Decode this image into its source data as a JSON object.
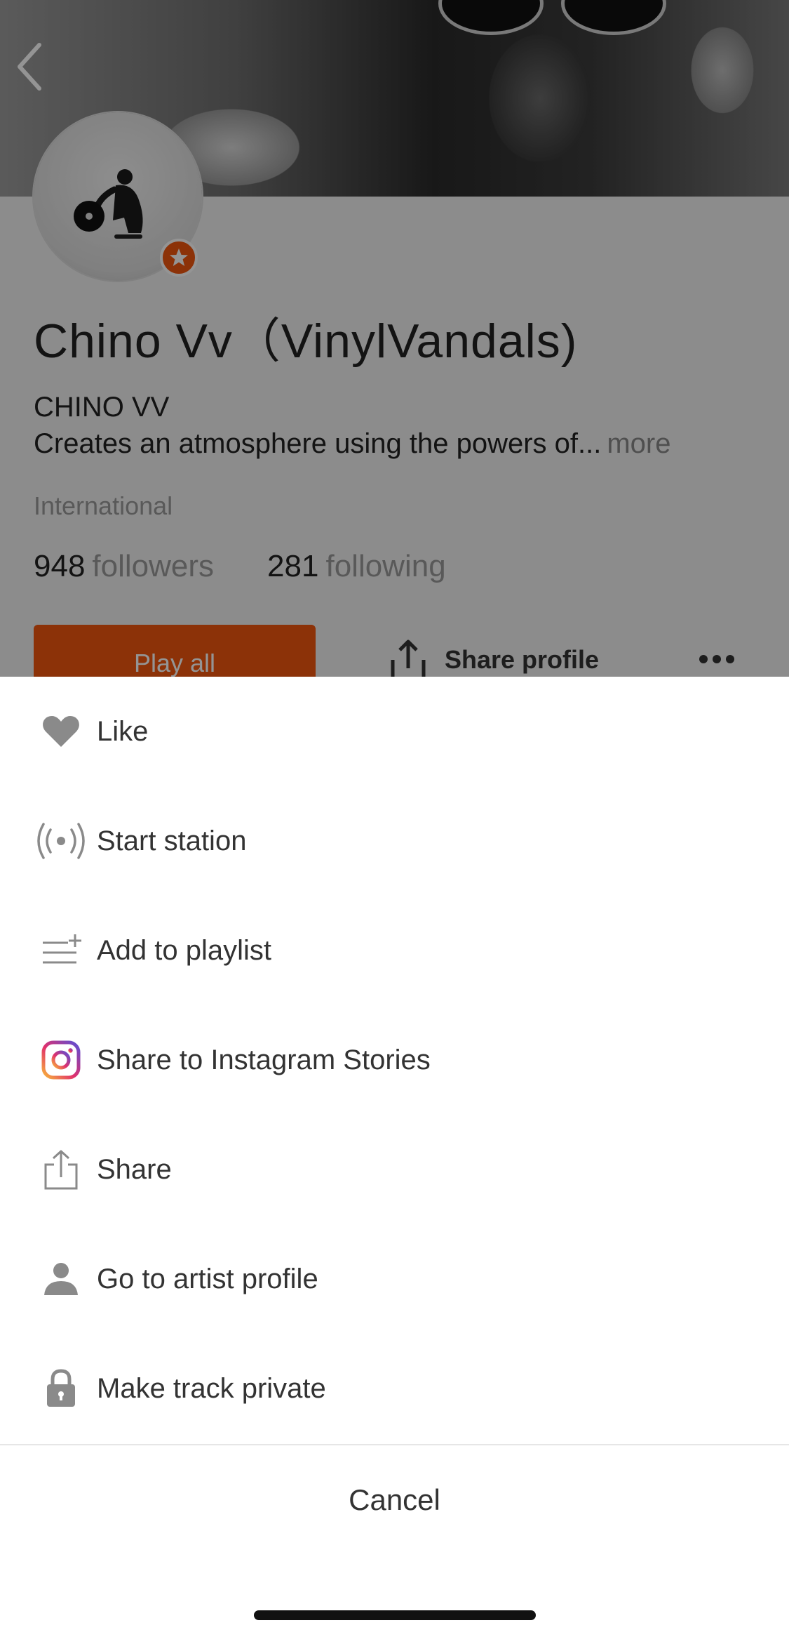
{
  "profile": {
    "artist_name": "Chino Vv（VinylVandals)",
    "real_name": "CHINO VV",
    "bio": "Creates an atmosphere using the powers of...",
    "bio_more": "more",
    "location": "International",
    "followers_count": "948",
    "followers_label": "followers",
    "following_count": "281",
    "following_label": "following",
    "play_all_label": "Play all",
    "share_profile_label": "Share profile",
    "accent_color": "#f2560e"
  },
  "action_sheet": {
    "items": [
      {
        "icon": "heart-icon",
        "label": "Like"
      },
      {
        "icon": "radio-station-icon",
        "label": "Start station"
      },
      {
        "icon": "add-to-playlist-icon",
        "label": "Add to playlist"
      },
      {
        "icon": "instagram-icon",
        "label": "Share to Instagram Stories"
      },
      {
        "icon": "share-icon",
        "label": "Share"
      },
      {
        "icon": "person-icon",
        "label": "Go to artist profile"
      },
      {
        "icon": "lock-icon",
        "label": "Make track private"
      }
    ],
    "cancel_label": "Cancel"
  }
}
